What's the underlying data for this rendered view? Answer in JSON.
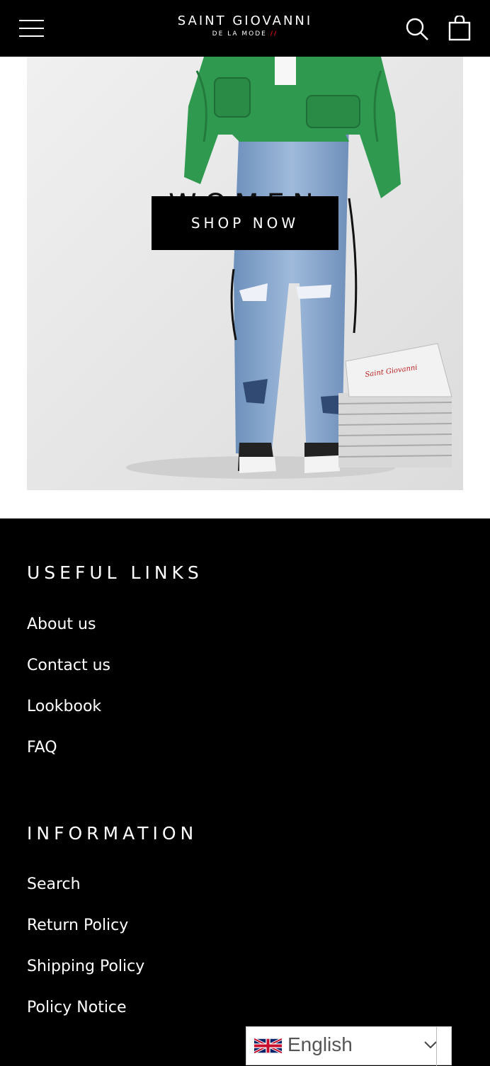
{
  "header": {
    "logo_main": "SAINT GIOVANNI",
    "logo_sub": "DE LA MODE",
    "icons": [
      "menu-icon",
      "search-icon",
      "cart-icon"
    ]
  },
  "hero": {
    "title": "WOMEN",
    "button_label": "SHOP NOW",
    "newspaper_text": "Saint Giovanni"
  },
  "footer": {
    "useful_links": {
      "heading": "USEFUL LINKS",
      "items": [
        "About us",
        "Contact us",
        "Lookbook",
        "FAQ"
      ]
    },
    "information": {
      "heading": "INFORMATION",
      "items": [
        "Search",
        "Return Policy",
        "Shipping Policy",
        "Policy Notice"
      ]
    }
  },
  "language": {
    "selected": "English",
    "flag": "uk-flag-icon"
  },
  "colors": {
    "header_bg": "#000000",
    "footer_bg": "#000000",
    "jacket_green": "#2f9a4f",
    "denim_blue": "#7fa0c8"
  }
}
